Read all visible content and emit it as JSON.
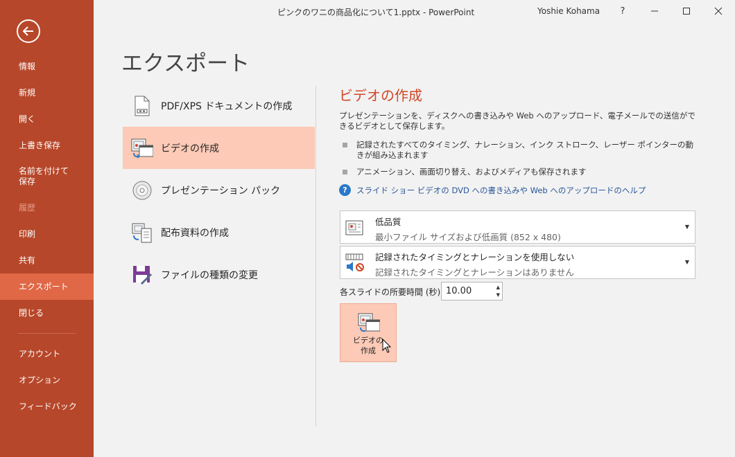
{
  "window": {
    "title": "ピンクのワニの商品化について1.pptx - PowerPoint",
    "user": "Yoshie Kohama",
    "help_label": "?",
    "minimize_label": "—",
    "maximize_label": "☐",
    "close_label": "✕"
  },
  "sidebar": {
    "back_icon": "back-arrow-icon",
    "items": [
      {
        "label": "情報"
      },
      {
        "label": "新規"
      },
      {
        "label": "開く"
      },
      {
        "label": "上書き保存"
      },
      {
        "label": "名前を付けて\n保存"
      },
      {
        "label": "履歴"
      },
      {
        "label": "印刷"
      },
      {
        "label": "共有"
      },
      {
        "label": "エクスポート"
      },
      {
        "label": "閉じる"
      },
      {
        "label": "アカウント"
      },
      {
        "label": "オプション"
      },
      {
        "label": "フィードバック"
      }
    ],
    "active": "エクスポート",
    "disabled": "履歴",
    "colors": {
      "background": "#b7472a",
      "active": "#e06846"
    }
  },
  "page": {
    "title": "エクスポート"
  },
  "options": [
    {
      "label": "PDF/XPS ドキュメントの作成",
      "icon": "pdf-document-icon"
    },
    {
      "label": "ビデオの作成",
      "icon": "video-icon"
    },
    {
      "label": "プレゼンテーション パック",
      "icon": "cd-package-icon"
    },
    {
      "label": "配布資料の作成",
      "icon": "handouts-icon"
    },
    {
      "label": "ファイルの種類の変更",
      "icon": "save-file-icon"
    }
  ],
  "panel": {
    "title": "ビデオの作成",
    "description": "プレゼンテーションを、ディスクへの書き込みや Web へのアップロード、電子メールでの送信ができるビデオとして保存します。",
    "bullets": [
      "記録されたすべてのタイミング、ナレーション、インク ストローク、レーザー ポインターの動きが組み込まれます",
      "アニメーション、画面切り替え、およびメディアも保存されます"
    ],
    "help_link": "スライド ショー ビデオの DVD への書き込みや Web へのアップロードのヘルプ",
    "quality": {
      "main": "低品質",
      "sub": "最小ファイル サイズおよび低画質 (852 x 480)"
    },
    "timing": {
      "main": "記録されたタイミングとナレーションを使用しない",
      "sub": "記録されたタイミングとナレーションはありません"
    },
    "duration_label": "各スライドの所要時間 (秒):",
    "duration_value": "10.00",
    "create_button": "ビデオの\n作成"
  }
}
